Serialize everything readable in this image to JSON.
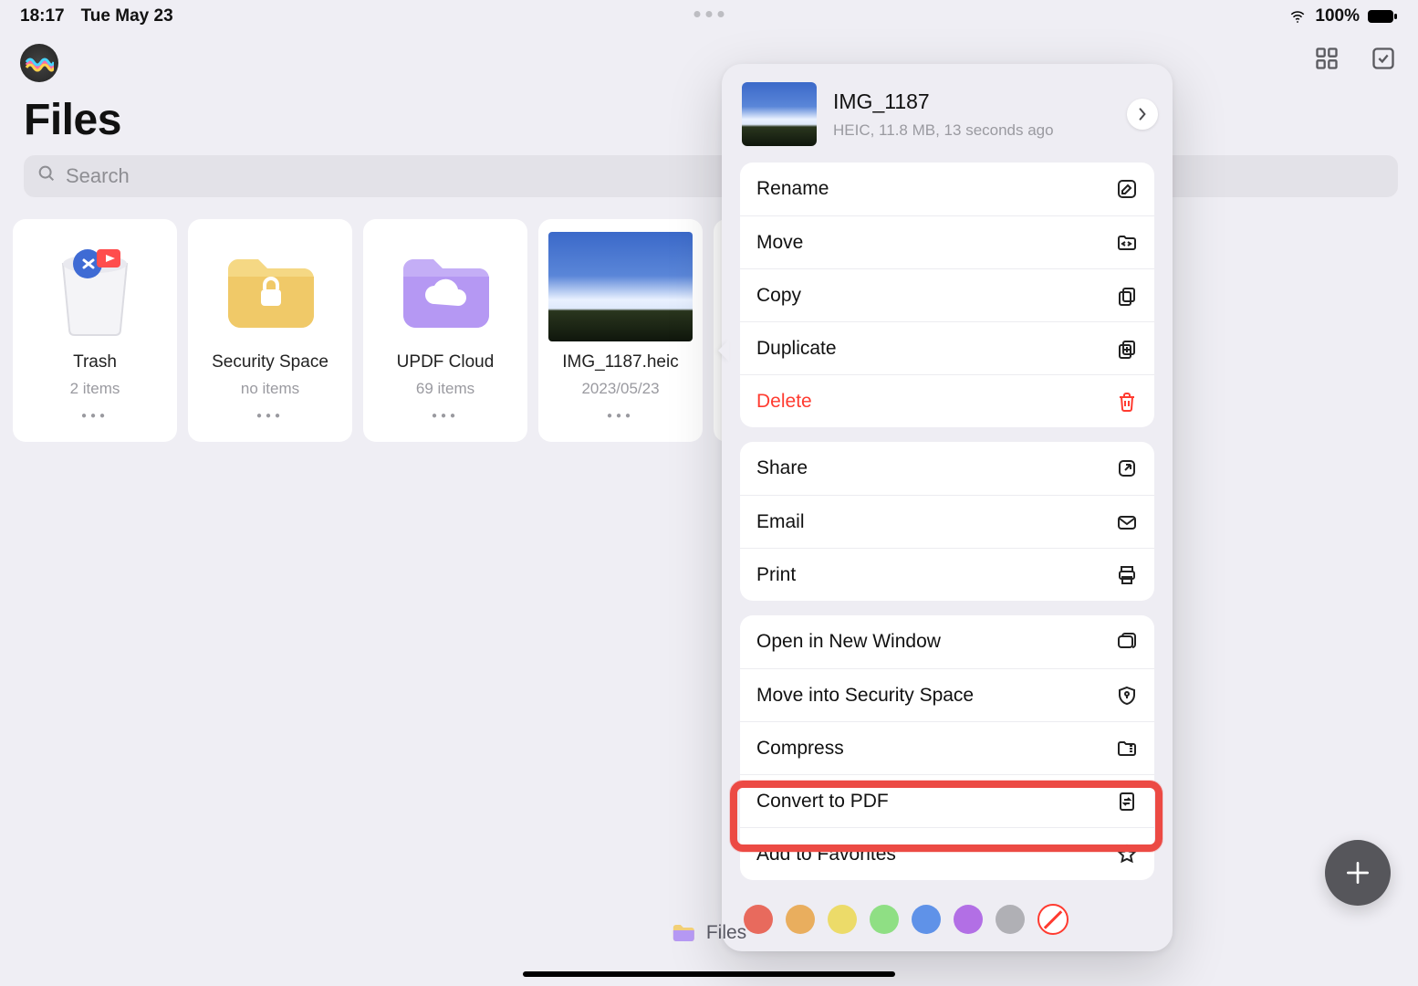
{
  "status": {
    "time": "18:17",
    "date": "Tue May 23",
    "battery": "100%"
  },
  "header": {
    "title": "Files"
  },
  "search": {
    "placeholder": "Search"
  },
  "grid": {
    "items": [
      {
        "type": "trash",
        "title": "Trash",
        "sub": "2 items"
      },
      {
        "type": "folder-lock",
        "title": "Security Space",
        "sub": "no items"
      },
      {
        "type": "folder-cloud",
        "title": "UPDF Cloud",
        "sub": "69 items"
      },
      {
        "type": "image",
        "title": "IMG_1187.heic",
        "sub": "2023/05/23"
      }
    ]
  },
  "bottom": {
    "label": "Files"
  },
  "popover": {
    "file_name": "IMG_1187",
    "meta": "HEIC, 11.8 MB, 13 seconds ago",
    "group1": [
      {
        "label": "Rename",
        "icon": "rename"
      },
      {
        "label": "Move",
        "icon": "move"
      },
      {
        "label": "Copy",
        "icon": "copy"
      },
      {
        "label": "Duplicate",
        "icon": "duplicate"
      },
      {
        "label": "Delete",
        "icon": "trash",
        "danger": true
      }
    ],
    "group2": [
      {
        "label": "Share",
        "icon": "share"
      },
      {
        "label": "Email",
        "icon": "mail"
      },
      {
        "label": "Print",
        "icon": "print"
      }
    ],
    "group3": [
      {
        "label": "Open in New Window",
        "icon": "window"
      },
      {
        "label": "Move into Security Space",
        "icon": "shield"
      },
      {
        "label": "Compress",
        "icon": "zip"
      },
      {
        "label": "Convert to PDF",
        "icon": "convert",
        "highlight": true
      },
      {
        "label": "Add to Favorites",
        "icon": "star"
      }
    ],
    "colors": [
      "#e86a5d",
      "#e9ae5e",
      "#ecdb69",
      "#8fdf84",
      "#5f92e8",
      "#b26fe5",
      "#b0b0b5"
    ]
  }
}
